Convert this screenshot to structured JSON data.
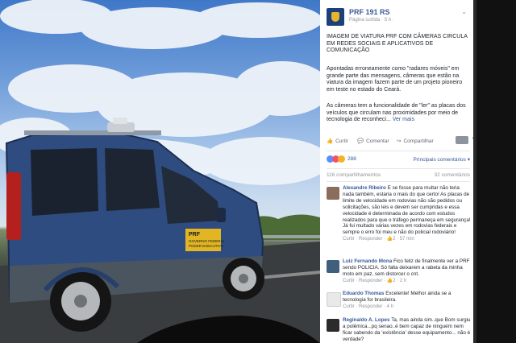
{
  "post": {
    "page_name": "PRF 191 RS",
    "subtitle": "Página curtida · 5 h · ",
    "headline": "IMAGEM DE VIATURA PRF COM CÂMERAS CIRCULA EM REDES SOCIAIS E APLICATIVOS DE COMUNICAÇÃO",
    "paragraph1": "Apontadas erroneamente como \"radares móveis\" em grande parte das mensagens, câmeras que estão na viatura da imagem fazem parte de um projeto pioneiro em teste no estado do Ceará.",
    "paragraph2": "As câmeras tem a funcionalidade de \"ler\" as placas dos veículos que circulam nas proximidades por meio de tecnologia de reconheci...",
    "see_more": "Ver mais"
  },
  "actions": {
    "like": "Curtir",
    "comment": "Comentar",
    "share": "Compartilhar"
  },
  "reactions": {
    "count": "288",
    "relevant": "Principais comentários ▾"
  },
  "counts": {
    "shares": "116 compartilhamentos",
    "comments": "32 comentários"
  },
  "photo": {
    "vehicle_label_title": "PRF",
    "vehicle_label_line1": "GOVERNO FEDERAL",
    "vehicle_label_line2": "PODER EXECUTIVO"
  },
  "comments": [
    {
      "name": "Alexandre Ribeiro",
      "text": "E se fosse para multar não teria nada também, estaria o mais do que certo! As placas de limite de velocidade em rodovias não são pedidos ou solicitações, são leis e devem ser cumpridas e essa velocidade é determinada de acordo com estudos realizados para que o tráfego permaneça em segurança! Já fui multado várias vezes em rodovias federais e sempre o erro foi meu e não do policial rodoviário!",
      "meta": "Curtir · Responder · 👍2 · 57 min"
    },
    {
      "name": "Luiz Fernando Mona",
      "text": "Fico feliz de finalmente ver a PRF sendo POLICIA. Só falta deixarem a rabeta da minha moto em paz, sem distorcer o cnt.",
      "meta": "Curtir · Responder · 👍2 · 2 h"
    },
    {
      "name": "Eduardo Thomas",
      "text": "Excelente! Melhor ainda se a tecnologia for brasileira.",
      "meta": "Curtir · Responder · 4 h"
    },
    {
      "name": "Reginaldo A. Lopes",
      "text": "Ta, mas ainda sim..que Bom surgiu a polêmica...pq senao..é bem capaz de ninguém nem ficar sabendo da 'existência' desse equipamento... não é verdade?",
      "meta": ""
    }
  ]
}
